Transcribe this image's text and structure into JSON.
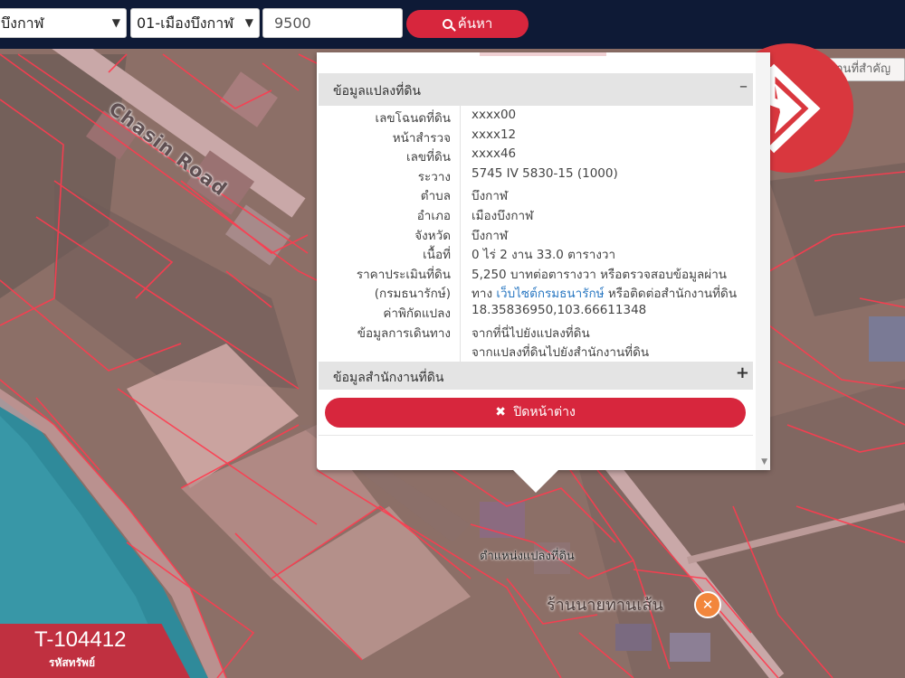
{
  "toolbar": {
    "province_select": "บึงกาฬ",
    "district_select": "01-เมืองบึงกาฬ",
    "parcel_input": "9500",
    "search_label": "ค้นหา"
  },
  "map": {
    "place_search_placeholder": "ค้นหาสถานที่สำคัญ",
    "road_label": "Chasin Road",
    "pin_label": "ตำแหน่งแปลงที่ดิน",
    "shop_label": "ร้านนายทานเส้น"
  },
  "popup": {
    "section_parcel": "ข้อมูลแปลงที่ดิน",
    "section_parcel_toggle": "–",
    "rows": [
      {
        "key": "เลขโฉนดที่ดิน",
        "value": "xxxx00"
      },
      {
        "key": "หน้าสำรวจ",
        "value": "xxxx12"
      },
      {
        "key": "เลขที่ดิน",
        "value": "xxxx46"
      },
      {
        "key": "ระวาง",
        "value": "5745 IV 5830-15 (1000)"
      },
      {
        "key": "ตำบล",
        "value": "บึงกาฬ"
      },
      {
        "key": "อำเภอ",
        "value": "เมืองบึงกาฬ"
      },
      {
        "key": "จังหวัด",
        "value": "บึงกาฬ"
      },
      {
        "key": "เนื้อที่",
        "value": "0 ไร่ 2 งาน 33.0 ตารางวา"
      },
      {
        "key": "ราคาประเมินที่ดิน",
        "value": "5,250 บาทต่อตารางวา หรือตรวจสอบข้อมูลผ่าน"
      }
    ],
    "appraisal_source_key": "(กรมธนารักษ์)",
    "appraisal_source_prefix": "ทาง",
    "appraisal_source_link": "เว็บไซต์กรมธนารักษ์",
    "appraisal_source_suffix": "หรือติดต่อสำนักงานที่ดิน",
    "coords_key": "ค่าพิกัดแปลง",
    "coords_value": "18.35836950,103.66611348",
    "travel_key": "ข้อมูลการเดินทาง",
    "travel_link_1": "จากที่นี่ไปยังแปลงที่ดิน",
    "travel_link_2": "จากแปลงที่ดินไปยังสำนักงานที่ดิน",
    "section_office": "ข้อมูลสำนักงานที่ดิน",
    "section_office_toggle": "+",
    "close_label": "ปิดหน้าต่าง"
  },
  "badge": {
    "code": "T-104412",
    "caption": "รหัสทรัพย์"
  },
  "colors": {
    "accent": "#d7263d",
    "toolbar": "#0e1a36",
    "parcel_lines": "#ff3b4f",
    "link": "#2a78c2"
  },
  "icons": [
    "search-icon",
    "close-icon",
    "map-pin-icon",
    "restaurant-icon",
    "brand-logo"
  ]
}
